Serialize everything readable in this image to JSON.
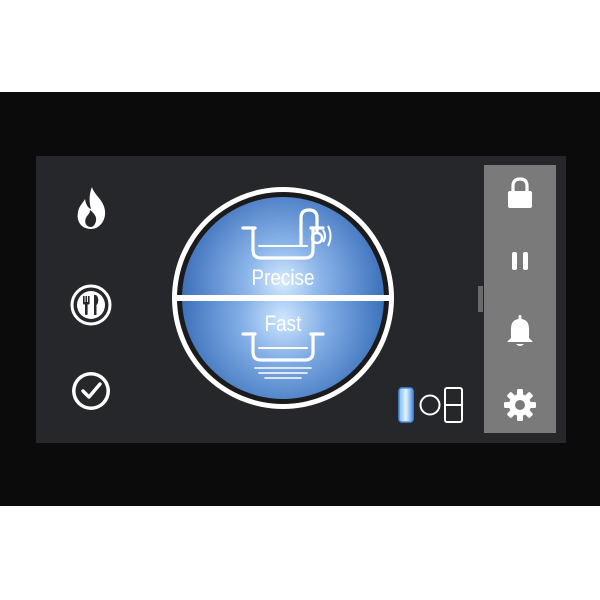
{
  "modes": {
    "precise_label": "Precise",
    "fast_label": "Fast"
  },
  "left_icons": [
    "flame-icon",
    "cutlery-icon",
    "timer-icon"
  ],
  "right_panel_icons": [
    "lock-icon",
    "pause-icon",
    "bell-icon",
    "gear-icon"
  ],
  "colors": {
    "dial_blue": "#4a7fc8",
    "dial_highlight": "#cfe6ff",
    "panel_gray": "#7a7a7a",
    "screen_bg": "#26272b",
    "active_indicator": "#4a90e2"
  }
}
